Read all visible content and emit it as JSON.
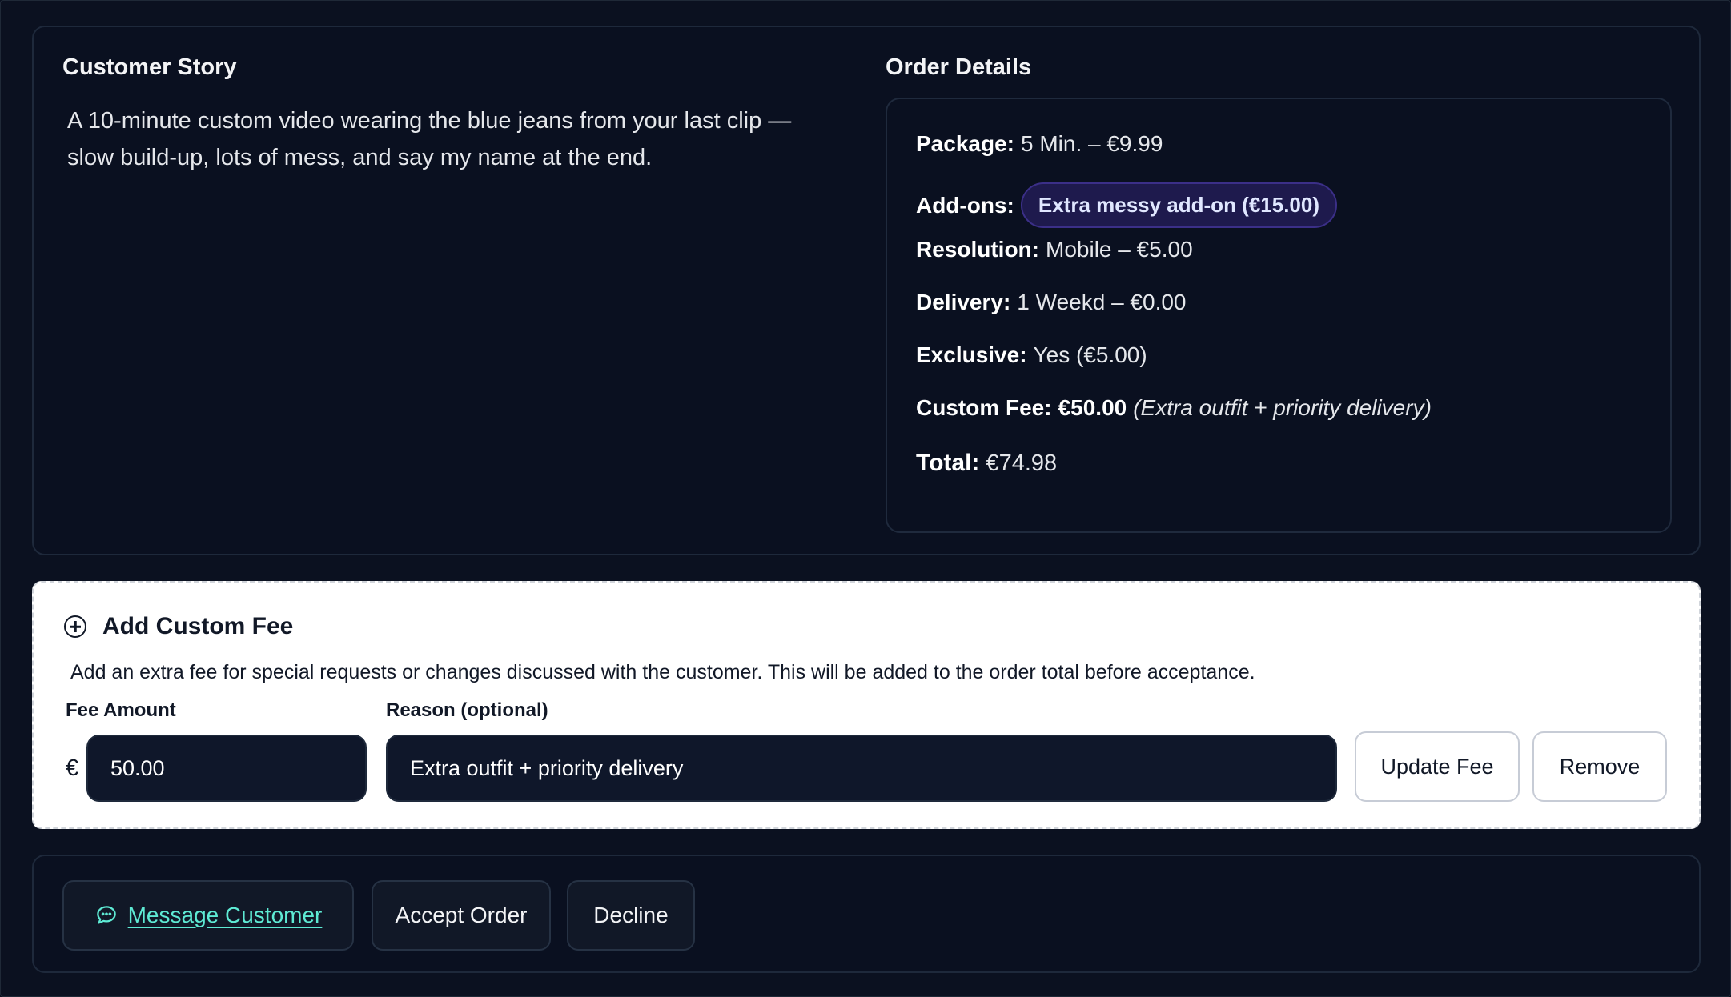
{
  "story": {
    "title": "Customer Story",
    "text": "A 10-minute custom video wearing the blue jeans from your last clip — slow build-up, lots of mess, and say my name at the end."
  },
  "order": {
    "title": "Order Details",
    "package_label": "Package:",
    "package_value": "5 Min. – €9.99",
    "addons_label": "Add-ons:",
    "addon_badge": "Extra messy add-on (€15.00)",
    "resolution_label": "Resolution:",
    "resolution_value": "Mobile – €5.00",
    "delivery_label": "Delivery:",
    "delivery_value": "1 Weekd – €0.00",
    "exclusive_label": "Exclusive:",
    "exclusive_value": "Yes (€5.00)",
    "fee_label": "Custom Fee:",
    "fee_value": "€50.00",
    "fee_note": "(Extra outfit + priority delivery)",
    "total_label": "Total:",
    "total_value": "€74.98"
  },
  "custom_fee": {
    "title": "Add Custom Fee",
    "description": "Add an extra fee for special requests or changes discussed with the customer. This will be added to the order total before acceptance.",
    "amount_label": "Fee Amount",
    "currency": "€",
    "amount_value": "50.00",
    "reason_label": "Reason (optional)",
    "reason_value": "Extra outfit + priority delivery",
    "update_button": "Update Fee",
    "remove_button": "Remove"
  },
  "actions": {
    "message_button": "Message Customer",
    "accept_button": "Accept Order",
    "decline_button": "Decline"
  },
  "colors": {
    "background": "#0b1120",
    "panel": "#0a1020",
    "accent_teal": "#5eead4",
    "badge_bg": "#1e1a4d"
  },
  "icons": {
    "add_fee": "plus-circle-icon",
    "message": "chat-bubble-icon"
  }
}
